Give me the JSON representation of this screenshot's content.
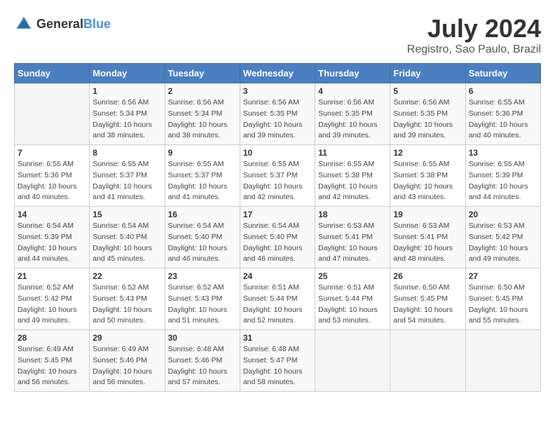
{
  "header": {
    "logo_general": "General",
    "logo_blue": "Blue",
    "title": "July 2024",
    "location": "Registro, Sao Paulo, Brazil"
  },
  "calendar": {
    "days_of_week": [
      "Sunday",
      "Monday",
      "Tuesday",
      "Wednesday",
      "Thursday",
      "Friday",
      "Saturday"
    ],
    "weeks": [
      [
        {
          "day": "",
          "info": ""
        },
        {
          "day": "1",
          "info": "Sunrise: 6:56 AM\nSunset: 5:34 PM\nDaylight: 10 hours\nand 38 minutes."
        },
        {
          "day": "2",
          "info": "Sunrise: 6:56 AM\nSunset: 5:34 PM\nDaylight: 10 hours\nand 38 minutes."
        },
        {
          "day": "3",
          "info": "Sunrise: 6:56 AM\nSunset: 5:35 PM\nDaylight: 10 hours\nand 39 minutes."
        },
        {
          "day": "4",
          "info": "Sunrise: 6:56 AM\nSunset: 5:35 PM\nDaylight: 10 hours\nand 39 minutes."
        },
        {
          "day": "5",
          "info": "Sunrise: 6:56 AM\nSunset: 5:35 PM\nDaylight: 10 hours\nand 39 minutes."
        },
        {
          "day": "6",
          "info": "Sunrise: 6:55 AM\nSunset: 5:36 PM\nDaylight: 10 hours\nand 40 minutes."
        }
      ],
      [
        {
          "day": "7",
          "info": "Sunrise: 6:55 AM\nSunset: 5:36 PM\nDaylight: 10 hours\nand 40 minutes."
        },
        {
          "day": "8",
          "info": "Sunrise: 6:55 AM\nSunset: 5:37 PM\nDaylight: 10 hours\nand 41 minutes."
        },
        {
          "day": "9",
          "info": "Sunrise: 6:55 AM\nSunset: 5:37 PM\nDaylight: 10 hours\nand 41 minutes."
        },
        {
          "day": "10",
          "info": "Sunrise: 6:55 AM\nSunset: 5:37 PM\nDaylight: 10 hours\nand 42 minutes."
        },
        {
          "day": "11",
          "info": "Sunrise: 6:55 AM\nSunset: 5:38 PM\nDaylight: 10 hours\nand 42 minutes."
        },
        {
          "day": "12",
          "info": "Sunrise: 6:55 AM\nSunset: 5:38 PM\nDaylight: 10 hours\nand 43 minutes."
        },
        {
          "day": "13",
          "info": "Sunrise: 6:55 AM\nSunset: 5:39 PM\nDaylight: 10 hours\nand 44 minutes."
        }
      ],
      [
        {
          "day": "14",
          "info": "Sunrise: 6:54 AM\nSunset: 5:39 PM\nDaylight: 10 hours\nand 44 minutes."
        },
        {
          "day": "15",
          "info": "Sunrise: 6:54 AM\nSunset: 5:40 PM\nDaylight: 10 hours\nand 45 minutes."
        },
        {
          "day": "16",
          "info": "Sunrise: 6:54 AM\nSunset: 5:40 PM\nDaylight: 10 hours\nand 46 minutes."
        },
        {
          "day": "17",
          "info": "Sunrise: 6:54 AM\nSunset: 5:40 PM\nDaylight: 10 hours\nand 46 minutes."
        },
        {
          "day": "18",
          "info": "Sunrise: 6:53 AM\nSunset: 5:41 PM\nDaylight: 10 hours\nand 47 minutes."
        },
        {
          "day": "19",
          "info": "Sunrise: 6:53 AM\nSunset: 5:41 PM\nDaylight: 10 hours\nand 48 minutes."
        },
        {
          "day": "20",
          "info": "Sunrise: 6:53 AM\nSunset: 5:42 PM\nDaylight: 10 hours\nand 49 minutes."
        }
      ],
      [
        {
          "day": "21",
          "info": "Sunrise: 6:52 AM\nSunset: 5:42 PM\nDaylight: 10 hours\nand 49 minutes."
        },
        {
          "day": "22",
          "info": "Sunrise: 6:52 AM\nSunset: 5:43 PM\nDaylight: 10 hours\nand 50 minutes."
        },
        {
          "day": "23",
          "info": "Sunrise: 6:52 AM\nSunset: 5:43 PM\nDaylight: 10 hours\nand 51 minutes."
        },
        {
          "day": "24",
          "info": "Sunrise: 6:51 AM\nSunset: 5:44 PM\nDaylight: 10 hours\nand 52 minutes."
        },
        {
          "day": "25",
          "info": "Sunrise: 6:51 AM\nSunset: 5:44 PM\nDaylight: 10 hours\nand 53 minutes."
        },
        {
          "day": "26",
          "info": "Sunrise: 6:50 AM\nSunset: 5:45 PM\nDaylight: 10 hours\nand 54 minutes."
        },
        {
          "day": "27",
          "info": "Sunrise: 6:50 AM\nSunset: 5:45 PM\nDaylight: 10 hours\nand 55 minutes."
        }
      ],
      [
        {
          "day": "28",
          "info": "Sunrise: 6:49 AM\nSunset: 5:45 PM\nDaylight: 10 hours\nand 56 minutes."
        },
        {
          "day": "29",
          "info": "Sunrise: 6:49 AM\nSunset: 5:46 PM\nDaylight: 10 hours\nand 56 minutes."
        },
        {
          "day": "30",
          "info": "Sunrise: 6:48 AM\nSunset: 5:46 PM\nDaylight: 10 hours\nand 57 minutes."
        },
        {
          "day": "31",
          "info": "Sunrise: 6:48 AM\nSunset: 5:47 PM\nDaylight: 10 hours\nand 58 minutes."
        },
        {
          "day": "",
          "info": ""
        },
        {
          "day": "",
          "info": ""
        },
        {
          "day": "",
          "info": ""
        }
      ]
    ]
  }
}
